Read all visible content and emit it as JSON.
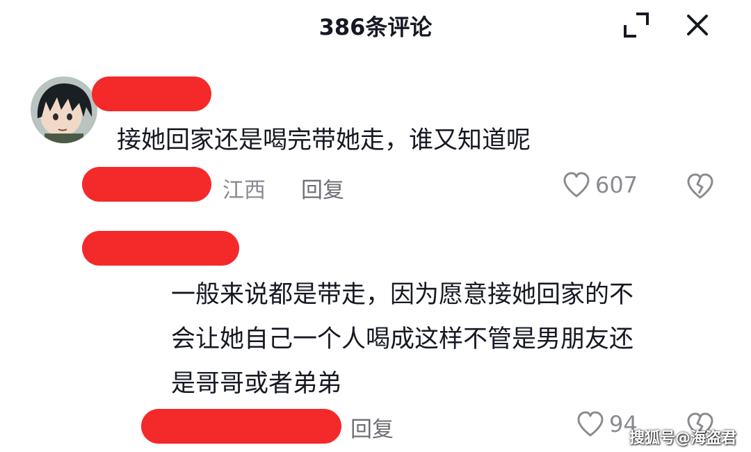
{
  "header": {
    "title": "386条评论",
    "expand_icon": "expand-icon",
    "close_icon": "close-icon"
  },
  "comments": [
    {
      "text": "接她回家还是喝完带她走，谁又知道呢",
      "location": "江西",
      "reply_label": "回复",
      "like_count": "607",
      "avatar": "anime-avatar"
    },
    {
      "text_lines": [
        "一般来说都是带走，因为愿意接她回家的不",
        "会让她自己一个人喝成这样不管是男朋友还",
        "是哥哥或者弟弟"
      ],
      "reply_label": "回复",
      "like_count": "94"
    }
  ],
  "watermark": "搜狐号@海盗君",
  "colors": {
    "redaction": "#f42a2a",
    "meta_text": "#8a8b91",
    "primary_text": "#161823"
  }
}
